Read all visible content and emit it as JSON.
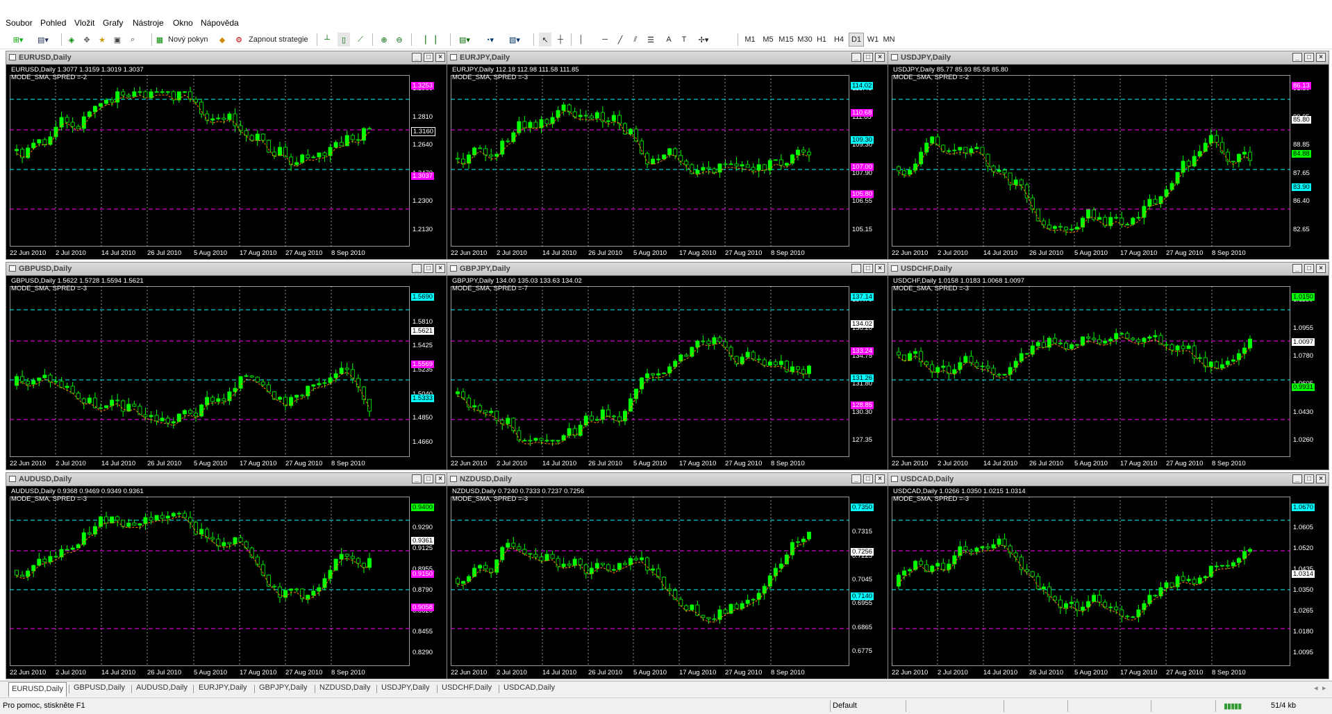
{
  "menu": [
    "Soubor",
    "Pohled",
    "Vložit",
    "Grafy",
    "Nástroje",
    "Okno",
    "Nápověda"
  ],
  "toolbar": {
    "new_order": "Nový pokyn",
    "enable_strategies": "Zapnout strategie",
    "timeframes": [
      "M1",
      "M5",
      "M15",
      "M30",
      "H1",
      "H4",
      "D1",
      "W1",
      "MN"
    ],
    "active_timeframe": "D1"
  },
  "dates": [
    "22 Jun 2010",
    "2 Jul 2010",
    "14 Jul 2010",
    "26 Jul 2010",
    "5 Aug 2010",
    "17 Aug 2010",
    "27 Aug 2010",
    "8 Sep 2010"
  ],
  "charts": [
    {
      "title": "EURUSD,Daily",
      "info1": "EURUSD,Daily  1.3077 1.3159 1.3019 1.3037",
      "info2": "MODE_SMA, SPRED =-2",
      "axis": [
        "1.2980",
        "1.2810",
        "1.2640",
        "1.2470",
        "1.2300",
        "1.2130"
      ],
      "labels": [
        {
          "t": "1.3253",
          "c": "#ff00ff"
        },
        {
          "t": "1.3160",
          "c": "#000"
        },
        {
          "t": "1.3037",
          "c": "#ff00ff"
        }
      ]
    },
    {
      "title": "EURJPY,Daily",
      "info1": "EURJPY,Daily  112.18 112.98 111.58 111.85",
      "info2": "MODE_SMA, SPRED =-3",
      "axis": [
        "113.45",
        "111.85",
        "109.30",
        "107.90",
        "106.55",
        "105.15"
      ],
      "labels": [
        {
          "t": "114.02",
          "c": "#00ffff"
        },
        {
          "t": "110.68",
          "c": "#ff00ff"
        },
        {
          "t": "109.30",
          "c": "#00ffff"
        },
        {
          "t": "107.00",
          "c": "#ff00ff"
        },
        {
          "t": "105.80",
          "c": "#ff00ff"
        }
      ]
    },
    {
      "title": "USDJPY,Daily",
      "info1": "USDJPY,Daily  85.77 85.93 85.58 85.80",
      "info2": "MODE_SMA, SPRED =-2",
      "axis": [
        "91.30",
        "90.05",
        "88.85",
        "87.65",
        "86.40",
        "82.65"
      ],
      "labels": [
        {
          "t": "86.13",
          "c": "#ff00ff"
        },
        {
          "t": "85.80",
          "c": "#fff"
        },
        {
          "t": "84.88",
          "c": "#00ff00"
        },
        {
          "t": "83.90",
          "c": "#00ffff"
        }
      ]
    },
    {
      "title": "GBPUSD,Daily",
      "info1": "GBPUSD,Daily  1.5622 1.5728 1.5594 1.5621",
      "info2": "MODE_SMA, SPRED =-3",
      "axis": [
        "1.6000",
        "1.5810",
        "1.5425",
        "1.5235",
        "1.5040",
        "1.4850",
        "1.4660"
      ],
      "labels": [
        {
          "t": "1.5690",
          "c": "#00ffff"
        },
        {
          "t": "1.5621",
          "c": "#fff"
        },
        {
          "t": "1.5569",
          "c": "#ff00ff"
        },
        {
          "t": "1.5333",
          "c": "#00ffff"
        }
      ]
    },
    {
      "title": "GBPJPY,Daily",
      "info1": "GBPJPY,Daily  134.00 135.03 133.63 134.02",
      "info2": "MODE_SMA, SPRED =-7",
      "axis": [
        "137.70",
        "136.20",
        "134.75",
        "131.80",
        "130.30",
        "127.35"
      ],
      "labels": [
        {
          "t": "137.14",
          "c": "#00ffff"
        },
        {
          "t": "134.02",
          "c": "#fff"
        },
        {
          "t": "133.24",
          "c": "#ff00ff"
        },
        {
          "t": "131.26",
          "c": "#00ffff"
        },
        {
          "t": "128.85",
          "c": "#ff00ff"
        }
      ]
    },
    {
      "title": "USDCHF,Daily",
      "info1": "USDCHF,Daily  1.0158 1.0183 1.0068 1.0097",
      "info2": "MODE_SMA, SPRED =-3",
      "axis": [
        "1.1130",
        "1.0955",
        "1.0780",
        "1.0605",
        "1.0430",
        "1.0260"
      ],
      "labels": [
        {
          "t": "1.0150",
          "c": "#00ff00"
        },
        {
          "t": "1.0097",
          "c": "#fff"
        },
        {
          "t": "0.9931",
          "c": "#00ff00"
        }
      ]
    },
    {
      "title": "AUDUSD,Daily",
      "info1": "AUDUSD,Daily  0.9368 0.9469 0.9349 0.9361",
      "info2": "MODE_SMA, SPRED =-3",
      "axis": [
        "0.9460",
        "0.9290",
        "0.9125",
        "0.8955",
        "0.8790",
        "0.8620",
        "0.8455",
        "0.8290"
      ],
      "labels": [
        {
          "t": "0.9400",
          "c": "#00ff00"
        },
        {
          "t": "0.9361",
          "c": "#fff"
        },
        {
          "t": "0.9150",
          "c": "#ff00ff"
        },
        {
          "t": "0.9058",
          "c": "#ff00ff"
        }
      ]
    },
    {
      "title": "NZDUSD,Daily",
      "info1": "NZDUSD,Daily  0.7240 0.7333 0.7237 0.7256",
      "info2": "MODE_SMA, SPRED =-3",
      "axis": [
        "0.7405",
        "0.7315",
        "0.7225",
        "0.7045",
        "0.6955",
        "0.6865",
        "0.6775"
      ],
      "labels": [
        {
          "t": "0.7350",
          "c": "#00ffff"
        },
        {
          "t": "0.7256",
          "c": "#fff"
        },
        {
          "t": "0.7140",
          "c": "#00ffff"
        }
      ]
    },
    {
      "title": "USDCAD,Daily",
      "info1": "USDCAD,Daily  1.0266 1.0350 1.0215 1.0314",
      "info2": "MODE_SMA, SPRED =-3",
      "axis": [
        "1.0690",
        "1.0605",
        "1.0520",
        "1.0435",
        "1.0350",
        "1.0265",
        "1.0180",
        "1.0095"
      ],
      "labels": [
        {
          "t": "1.0670",
          "c": "#00ffff"
        },
        {
          "t": "1.0314",
          "c": "#fff"
        }
      ]
    }
  ],
  "tabs": [
    "EURUSD,Daily",
    "GBPUSD,Daily",
    "AUDUSD,Daily",
    "EURJPY,Daily",
    "GBPJPY,Daily",
    "NZDUSD,Daily",
    "USDJPY,Daily",
    "USDCHF,Daily",
    "USDCAD,Daily"
  ],
  "active_tab": "EURUSD,Daily",
  "status": {
    "help": "Pro pomoc, stiskněte F1",
    "profile": "Default",
    "traffic": "51/4 kb"
  },
  "colors": {
    "bull": "#00ff00",
    "bear": "#000000",
    "wick": "#00ff00",
    "sma": "#ff8000",
    "cyan": "#00ffff",
    "magenta": "#ff00ff"
  }
}
